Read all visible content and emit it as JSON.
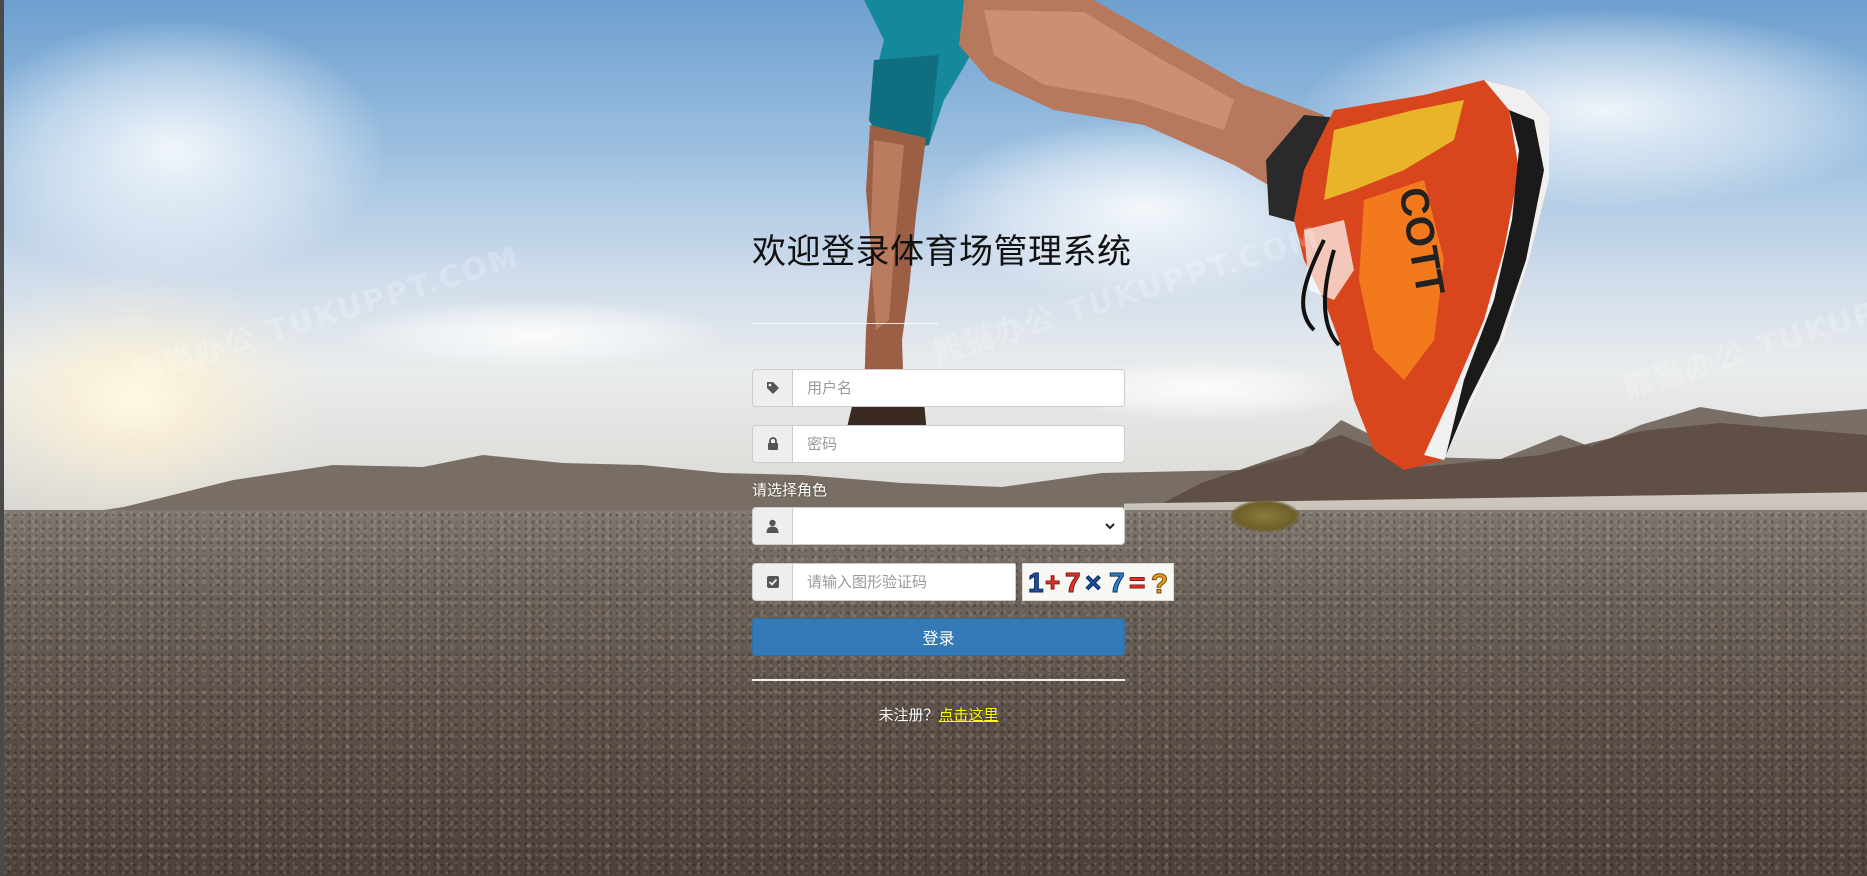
{
  "title": "欢迎登录体育场管理系统",
  "form": {
    "username": {
      "placeholder": "用户名",
      "value": "",
      "icon": "tag-icon"
    },
    "password": {
      "placeholder": "密码",
      "value": "",
      "icon": "lock-icon"
    },
    "role": {
      "label": "请选择角色",
      "selected": "",
      "icon": "user-icon"
    },
    "captcha": {
      "placeholder": "请输入图形验证码",
      "value": "",
      "icon": "check-square-icon",
      "image_text": "1+7×7=?"
    },
    "submit_label": "登录"
  },
  "register": {
    "prompt": "未注册？",
    "link": "点击这里"
  },
  "watermark": "熊猫办公 TUKUPPT.COM",
  "colors": {
    "primary_button": "#337ab7",
    "register_link": "#ffff00"
  }
}
